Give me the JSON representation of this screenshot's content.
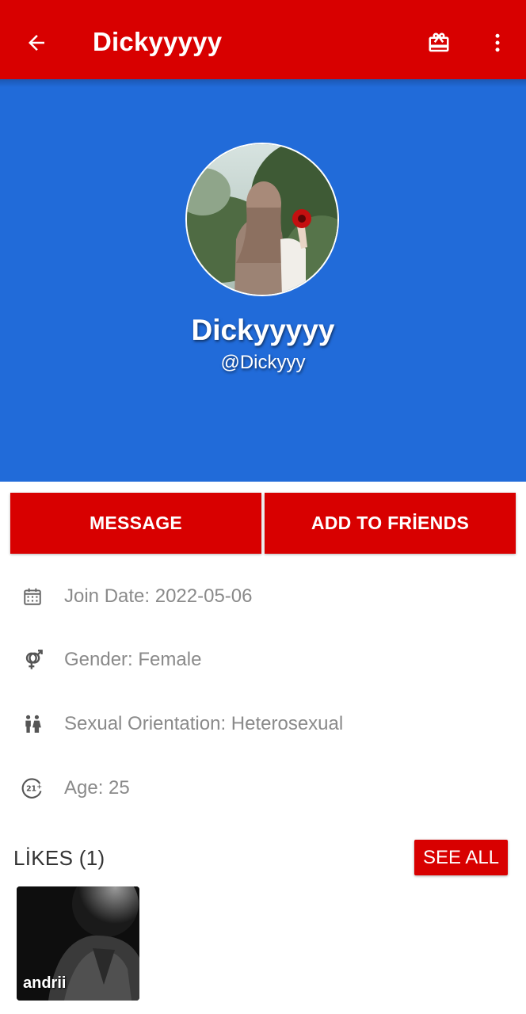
{
  "appbar": {
    "title": "Dickyyyyy",
    "back_icon": "arrow-left-icon",
    "gift_icon": "gift-icon",
    "more_icon": "more-vertical-icon",
    "color": "#d80000"
  },
  "profile": {
    "display_name": "Dickyyyyy",
    "handle": "@Dickyyy",
    "banner_color": "#216bd9"
  },
  "actions": {
    "message_label": "MESSAGE",
    "add_friend_label": "ADD TO FRİENDS"
  },
  "info": [
    {
      "icon": "calendar-icon",
      "text": "Join Date: 2022-05-06"
    },
    {
      "icon": "gender-icon",
      "text": "Gender: Female"
    },
    {
      "icon": "couple-icon",
      "text": "Sexual Orientation: Heterosexual"
    },
    {
      "icon": "age-21-plus-icon",
      "text": "Age: 25"
    }
  ],
  "likes": {
    "title": "LİKES (1)",
    "see_all_label": "SEE ALL",
    "items": [
      {
        "name": "andrii"
      }
    ]
  }
}
